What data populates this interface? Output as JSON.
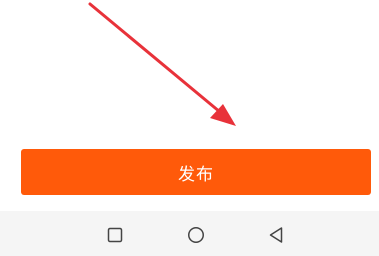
{
  "publish_button": {
    "label": "发布",
    "color": "#ff5a0a"
  },
  "nav_bar": {
    "buttons": [
      {
        "name": "recent-apps",
        "icon": "square-icon"
      },
      {
        "name": "home",
        "icon": "circle-icon"
      },
      {
        "name": "back",
        "icon": "triangle-back-icon"
      }
    ]
  },
  "annotation_arrow": {
    "color": "#e8323a"
  }
}
